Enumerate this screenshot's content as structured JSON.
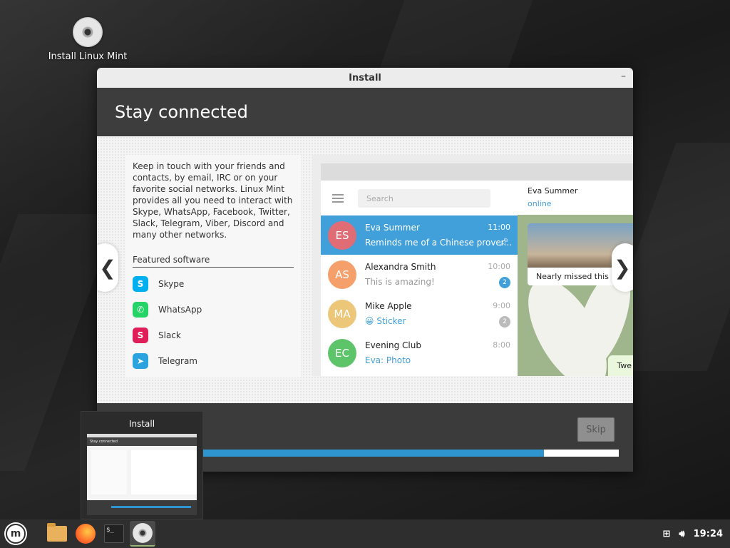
{
  "desktop": {
    "icon_label": "Install Linux Mint"
  },
  "window": {
    "title": "Install",
    "minimize_glyph": "–",
    "heading": "Stay connected",
    "description": "Keep in touch with your friends and contacts, by email, IRC or on your favorite social networks. Linux Mint provides all you need to interact with Skype, WhatsApp, Facebook, Twitter, Slack, Telegram, Viber, Discord and many other networks.",
    "featured_title": "Featured software",
    "featured_apps": [
      {
        "name": "Skype",
        "icon": "skype-icon",
        "color": "#00aff0",
        "glyph": "S"
      },
      {
        "name": "WhatsApp",
        "icon": "whatsapp-icon",
        "color": "#25d366",
        "glyph": "✆"
      },
      {
        "name": "Slack",
        "icon": "slack-icon",
        "color": "#e01e5a",
        "glyph": "S"
      },
      {
        "name": "Telegram",
        "icon": "telegram-icon",
        "color": "#2aa3de",
        "glyph": "➤"
      }
    ],
    "nav_prev": "❮",
    "nav_next": "❯",
    "skip_label": "Skip",
    "progress": 0.82
  },
  "mockup": {
    "search_placeholder": "Search",
    "chats": [
      {
        "initials": "ES",
        "name": "Eva Summer",
        "preview": "Reminds me of a Chinese prover...",
        "time": "11:00",
        "badge": "",
        "color": "#e06c75"
      },
      {
        "initials": "AS",
        "name": "Alexandra Smith",
        "preview": "This is amazing!",
        "time": "10:00",
        "badge": "2",
        "color": "#f5a06b"
      },
      {
        "initials": "MA",
        "name": "Mike Apple",
        "preview": "😀 Sticker",
        "time": "9:00",
        "badge": "2",
        "color": "#ecc77a"
      },
      {
        "initials": "EC",
        "name": "Evening Club",
        "preview": "Eva: Photo",
        "time": "8:00",
        "badge": "",
        "color": "#5ec46a"
      }
    ],
    "conv_name": "Eva Summer",
    "conv_status": "online",
    "msg_text": "Nearly missed this s",
    "msg_bottom": "Twe"
  },
  "preview": {
    "title": "Install",
    "thumb_heading": "Stay connected"
  },
  "taskbar": {
    "menu_glyph": "m",
    "terminal_text": "$_",
    "clock": "19:24",
    "network_icon": "network-icon",
    "volume_icon": "volume-icon"
  },
  "colors": {
    "accent": "#2f95d1",
    "active_chat": "#419fd9"
  }
}
